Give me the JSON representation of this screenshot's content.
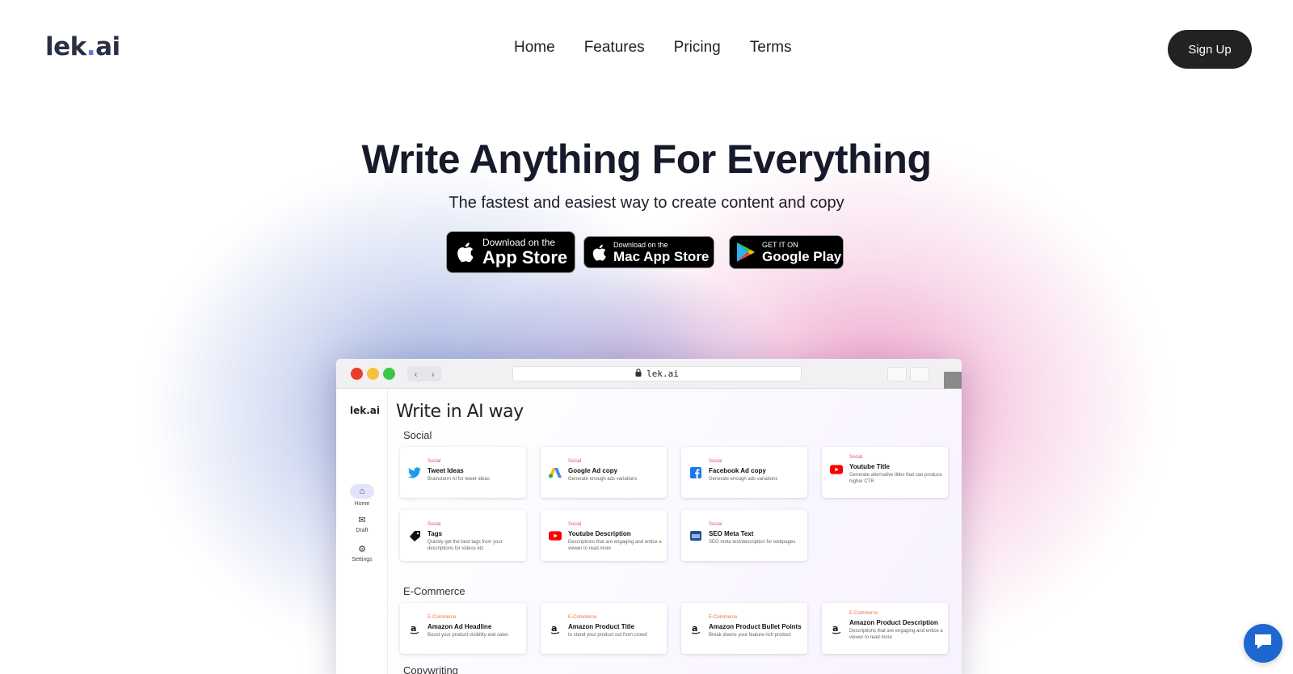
{
  "header": {
    "logo_text_a": "lek",
    "logo_text_dot": ".",
    "logo_text_b": "ai",
    "nav": [
      "Home",
      "Features",
      "Pricing",
      "Terms"
    ],
    "signup_label": "Sign Up"
  },
  "hero": {
    "title": "Write Anything For Everything",
    "subtitle": "The fastest and easiest way to create content and copy",
    "badges": {
      "app_store": {
        "line1": "Download on the",
        "line2": "App Store"
      },
      "mac_app_store": {
        "line1": "Download on the",
        "line2": "Mac App Store"
      },
      "google_play": {
        "line1": "GET IT ON",
        "line2": "Google Play"
      }
    }
  },
  "browser": {
    "url": "lek.ai",
    "app_logo": "lek.ai",
    "sidebar": [
      {
        "label": "Home",
        "icon": "home-icon"
      },
      {
        "label": "Draft",
        "icon": "inbox-icon"
      },
      {
        "label": "Settings",
        "icon": "gear-icon"
      }
    ],
    "main_title": "Write in AI way",
    "sections": {
      "social": {
        "title": "Social",
        "cards": [
          {
            "category": "Social",
            "title": "Tweet Ideas",
            "desc": "Brainstorm AI for tweet ideas",
            "icon": "twitter-icon"
          },
          {
            "category": "Social",
            "title": "Google Ad copy",
            "desc": "Generate enough ads variations",
            "icon": "google-ads-icon"
          },
          {
            "category": "Social",
            "title": "Facebook Ad copy",
            "desc": "Generate enough ads variations",
            "icon": "facebook-icon"
          },
          {
            "category": "Social",
            "title": "Youtube Title",
            "desc": "Generate alternative titles that can produce higher CTR",
            "icon": "youtube-icon"
          },
          {
            "category": "Social",
            "title": "Tags",
            "desc": "Quickly get the best tags from your descriptions for videos etc",
            "icon": "tag-icon"
          },
          {
            "category": "Social",
            "title": "Youtube Description",
            "desc": "Descriptions that are engaging and entice a viewer to read more",
            "icon": "youtube-icon"
          },
          {
            "category": "Social",
            "title": "SEO Meta Text",
            "desc": "SEO meta text/description for webpages",
            "icon": "seo-icon"
          }
        ]
      },
      "ecommerce": {
        "title": "E-Commerce",
        "cards": [
          {
            "category": "E-Commerce",
            "title": "Amazon Ad Headline",
            "desc": "Boost your product visibility and sales",
            "icon": "amazon-icon"
          },
          {
            "category": "E-Commerce",
            "title": "Amazon Product Title",
            "desc": "to stand your product out from crowd",
            "icon": "amazon-icon"
          },
          {
            "category": "E-Commerce",
            "title": "Amazon Product Bullet Points",
            "desc": "Break downs your feature-rich product",
            "icon": "amazon-icon"
          },
          {
            "category": "E-Commerce",
            "title": "Amazon Product Description",
            "desc": "Descriptions that are engaging and entice a viewer to read more",
            "icon": "amazon-icon"
          }
        ]
      },
      "copywriting": {
        "title": "Copywriting"
      }
    }
  },
  "colors": {
    "accent_dark": "#222222",
    "logo_dot": "#5f7dd8",
    "social_category": "#e0557a",
    "ecom_category": "#e7753b",
    "chat_button": "#1e66d0"
  }
}
